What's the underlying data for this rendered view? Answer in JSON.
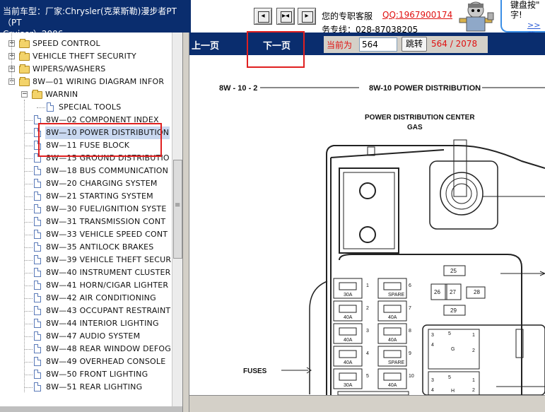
{
  "header": {
    "vehicle_line1": "当前车型：厂家:Chrysler(克莱斯勒)漫步者PT（PT",
    "vehicle_line2": "Cruiser）2006",
    "service_label": "您的专职客服",
    "service_qq": "QQ:1967900174",
    "service_hotline": "务专线：028-87038205",
    "tip_text": "键盘按\"\n字!",
    "tip_more": ">>菜"
  },
  "nav_buttons": [
    {
      "name": "toolbar-button-prev-icon",
      "glyph": "◂"
    },
    {
      "name": "toolbar-button-fit-icon",
      "glyph": "▸◂"
    },
    {
      "name": "toolbar-button-next-icon",
      "glyph": "▸"
    }
  ],
  "pager": {
    "prev_label": "上一页",
    "next_label": "下一页",
    "current_label": "当前为",
    "current_page": "564",
    "go_label": "跳转",
    "page_count": "564 / 2078"
  },
  "tree": {
    "items": [
      {
        "label": "SPEED CONTROL",
        "kind": "folder",
        "expander": "+"
      },
      {
        "label": "VEHICLE THEFT SECURITY",
        "kind": "folder",
        "expander": "+"
      },
      {
        "label": "WIPERS/WASHERS",
        "kind": "folder",
        "expander": "+"
      },
      {
        "label": "8W—01 WIRING DIAGRAM INFOR",
        "kind": "folder",
        "expander": "−"
      },
      {
        "label": "WARNIN",
        "kind": "folder",
        "expander": "−"
      },
      {
        "label": "SPECIAL TOOLS",
        "kind": "doc"
      },
      {
        "label": "8W—02 COMPONENT INDEX",
        "kind": "doc"
      },
      {
        "label": "8W—10 POWER DISTRIBUTION",
        "kind": "doc"
      },
      {
        "label": "8W—11 FUSE BLOCK",
        "kind": "doc"
      },
      {
        "label": "8W—15 GROUND DISTRIBUTIO",
        "kind": "doc"
      },
      {
        "label": "8W—18 BUS COMMUNICATION",
        "kind": "doc"
      },
      {
        "label": "8W—20 CHARGING SYSTEM",
        "kind": "doc"
      },
      {
        "label": "8W—21 STARTING SYSTEM",
        "kind": "doc"
      },
      {
        "label": "8W—30 FUEL/IGNITION SYSTE",
        "kind": "doc"
      },
      {
        "label": "8W—31 TRANSMISSION CONT",
        "kind": "doc"
      },
      {
        "label": "8W—33 VEHICLE SPEED CONT",
        "kind": "doc"
      },
      {
        "label": "8W—35 ANTILOCK BRAKES",
        "kind": "doc"
      },
      {
        "label": "8W—39 VEHICLE THEFT SECUR",
        "kind": "doc"
      },
      {
        "label": "8W—40 INSTRUMENT CLUSTER",
        "kind": "doc"
      },
      {
        "label": "8W—41 HORN/CIGAR LIGHTER",
        "kind": "doc"
      },
      {
        "label": "8W—42 AIR CONDITIONING",
        "kind": "doc"
      },
      {
        "label": "8W—43 OCCUPANT RESTRAINT",
        "kind": "doc"
      },
      {
        "label": "8W—44 INTERIOR LIGHTING",
        "kind": "doc"
      },
      {
        "label": "8W—47 AUDIO SYSTEM",
        "kind": "doc"
      },
      {
        "label": "8W—48 REAR WINDOW DEFOG",
        "kind": "doc"
      },
      {
        "label": "8W—49 OVERHEAD CONSOLE",
        "kind": "doc"
      },
      {
        "label": "8W—50 FRONT LIGHTING",
        "kind": "doc"
      },
      {
        "label": "8W—51 REAR LIGHTING",
        "kind": "doc"
      }
    ],
    "selected_index": 7
  },
  "diagram": {
    "page_ref": "8W - 10 - 2",
    "section_title": "8W-10 POWER DISTRIBUTION",
    "pdc_line1": "POWER DISTRIBUTION CENTER",
    "pdc_line2": "GAS",
    "fuses_label": "FUSES",
    "relay_numbers": [
      "25",
      "26",
      "27",
      "28",
      "29"
    ],
    "fuse_left": [
      {
        "num": "1",
        "amp": "30A"
      },
      {
        "num": "2",
        "amp": "40A"
      },
      {
        "num": "3",
        "amp": "40A"
      },
      {
        "num": "4",
        "amp": "40A"
      },
      {
        "num": "5",
        "amp": "30A"
      }
    ],
    "fuse_right": [
      {
        "num": "6",
        "amp": "SPARE"
      },
      {
        "num": "7",
        "amp": "40A"
      },
      {
        "num": "8",
        "amp": "40A"
      },
      {
        "num": "9",
        "amp": "SPARE"
      },
      {
        "num": "10",
        "amp": "40A"
      }
    ],
    "relay_pins_top": [
      "3",
      "5",
      "1",
      "4",
      "2"
    ],
    "relay_pins_bottom": [
      "3",
      "5",
      "1",
      "4",
      "2"
    ],
    "relay_tags": [
      "G",
      "H"
    ]
  },
  "colors": {
    "header_blue": "#0a2d6e",
    "accent_red": "#e01010",
    "selection": "#c9d8f0"
  }
}
